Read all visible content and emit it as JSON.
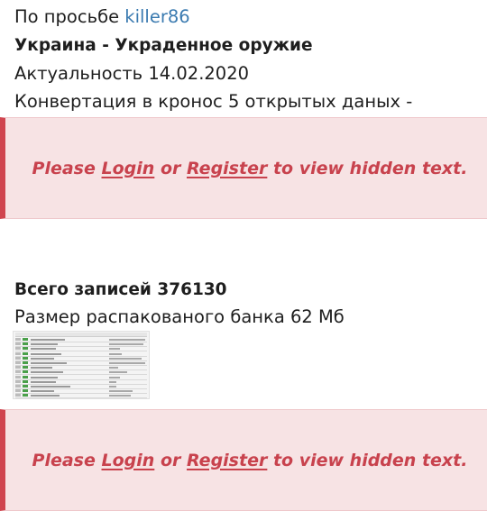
{
  "post": {
    "request_prefix": "По просьбе",
    "request_user": "killer86",
    "title": "Украина - Украденное оружие",
    "actuality": "Актуальность 14.02.2020",
    "conversion": "Конвертация в кронос 5 открытых даных -",
    "total_records": "Всего записей 376130",
    "unpacked_size": "Размер распакованого банка 62 Мб"
  },
  "hidden_notice": {
    "please": "Please",
    "login": "Login",
    "or": "or",
    "register": "Register",
    "suffix": "to view hidden text."
  },
  "colors": {
    "link": "#3a7ab0",
    "notice_text": "#c8424d",
    "notice_bg": "#f7e3e4",
    "notice_border": "#d0454f"
  },
  "thumbnail": {
    "icon": "spreadsheet-preview-image"
  }
}
